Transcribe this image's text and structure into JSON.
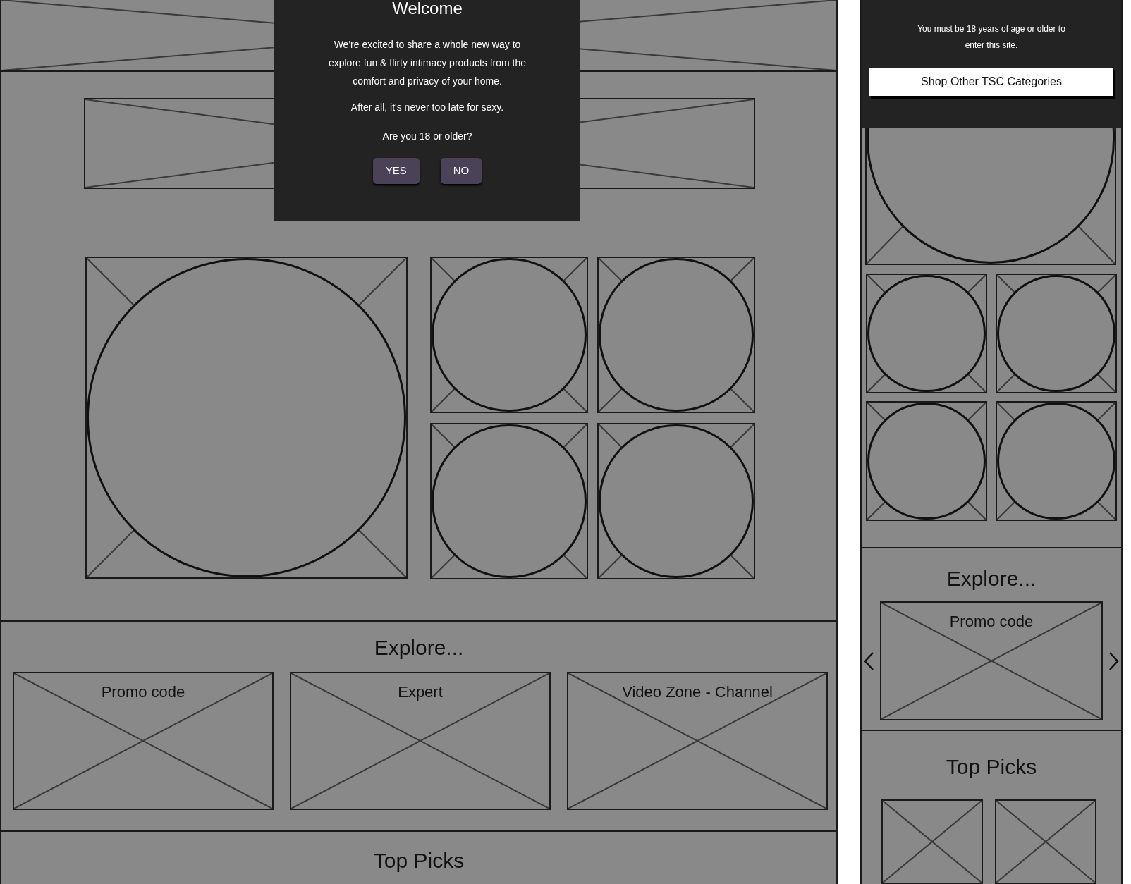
{
  "desktop": {
    "welcome_dialog": {
      "title": "Welcome",
      "message": "We're excited to share a whole new way to explore fun & flirty intimacy products from the comfort and privacy of your home.",
      "closing": "After all, it's never too late for sexy.",
      "question": "Are you 18 or older?",
      "buttons": [
        "YES",
        "NO"
      ]
    },
    "explore": {
      "title": "Explore...",
      "cards": [
        "Promo code",
        "Expert",
        "Video Zone - Channel"
      ]
    },
    "top_picks": {
      "title": "Top Picks"
    }
  },
  "mobile": {
    "age_notice": {
      "message": "You must be 18 years of age or older to enter this site.",
      "button": "Shop Other TSC Categories"
    },
    "explore": {
      "title": "Explore...",
      "cards": [
        "Promo code"
      ]
    },
    "top_picks": {
      "title": "Top Picks"
    }
  }
}
